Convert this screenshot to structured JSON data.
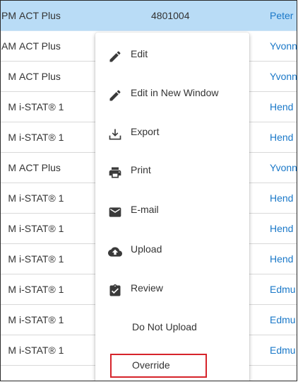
{
  "rows": [
    {
      "time": "PM",
      "device": "ACT Plus",
      "id": "4801004",
      "user": "Peter",
      "selected": true
    },
    {
      "time": "AM",
      "device": "ACT Plus",
      "id": "",
      "user": "Yvonn"
    },
    {
      "time": "M",
      "device": "ACT Plus",
      "id": "",
      "user": "Yvonn"
    },
    {
      "time": "M",
      "device": "i-STAT® 1",
      "id": "",
      "user": "Hend"
    },
    {
      "time": "M",
      "device": "i-STAT® 1",
      "id": "",
      "user": "Hend"
    },
    {
      "time": "M",
      "device": "ACT Plus",
      "id": "",
      "user": "Yvonn"
    },
    {
      "time": "M",
      "device": "i-STAT® 1",
      "id": "",
      "user": "Hend"
    },
    {
      "time": "M",
      "device": "i-STAT® 1",
      "id": "",
      "user": "Hend"
    },
    {
      "time": "M",
      "device": "i-STAT® 1",
      "id": "",
      "user": "Hend"
    },
    {
      "time": "M",
      "device": "i-STAT® 1",
      "id": "",
      "user": "Edmu"
    },
    {
      "time": "M",
      "device": "i-STAT® 1",
      "id": "",
      "user": "Edmu"
    },
    {
      "time": "M",
      "device": "i-STAT® 1",
      "id": "",
      "user": "Edmu"
    }
  ],
  "menu": {
    "edit": "Edit",
    "edit_new_window": "Edit in New Window",
    "export": "Export",
    "print": "Print",
    "email": "E-mail",
    "upload": "Upload",
    "review": "Review",
    "do_not_upload": "Do Not Upload",
    "override": "Override"
  },
  "colors": {
    "selected_row": "#b9dcf6",
    "user_link": "#1a78c8",
    "icon": "#3a3a3a",
    "highlight_box": "#d6242b"
  }
}
